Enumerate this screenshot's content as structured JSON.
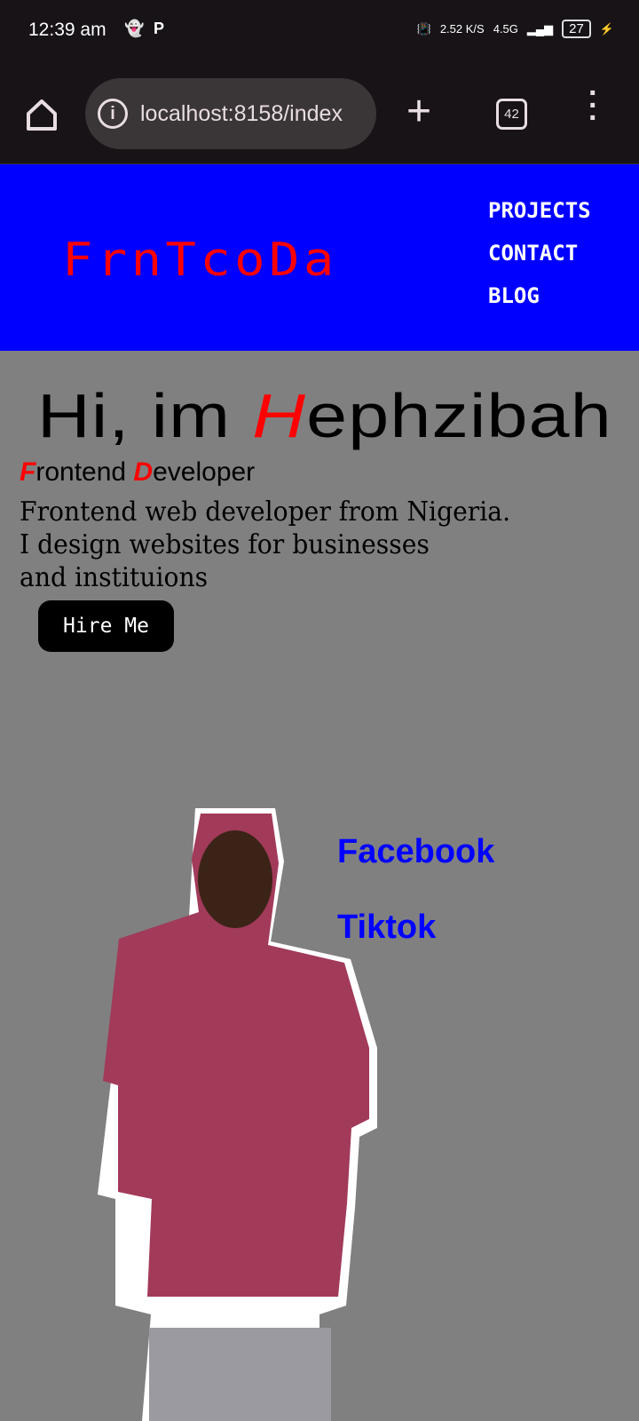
{
  "status_bar": {
    "time": "12:39 am",
    "net_speed": "2.52",
    "net_unit": "K/S",
    "network": "4.5G",
    "battery": "27"
  },
  "browser": {
    "url": "localhost:8158/index",
    "tab_count": "42"
  },
  "header": {
    "logo": "FrnTcoDa",
    "nav": [
      "PROJECTS",
      "CONTACT",
      "BLOG"
    ]
  },
  "hero": {
    "greeting": "Hi, im ",
    "name_initial": "H",
    "name_rest": "ephzibah",
    "role_f": "F",
    "role_1": "rontend ",
    "role_d": "D",
    "role_2": "eveloper",
    "description": [
      "Frontend web developer from Nigeria.",
      "I design websites for businesses",
      "and instituions"
    ],
    "hire_label": "Hire Me"
  },
  "social": [
    "Facebook",
    "Tiktok"
  ],
  "colors": {
    "header": "#0000ff",
    "background": "#808080",
    "accent": "#ff0000"
  }
}
